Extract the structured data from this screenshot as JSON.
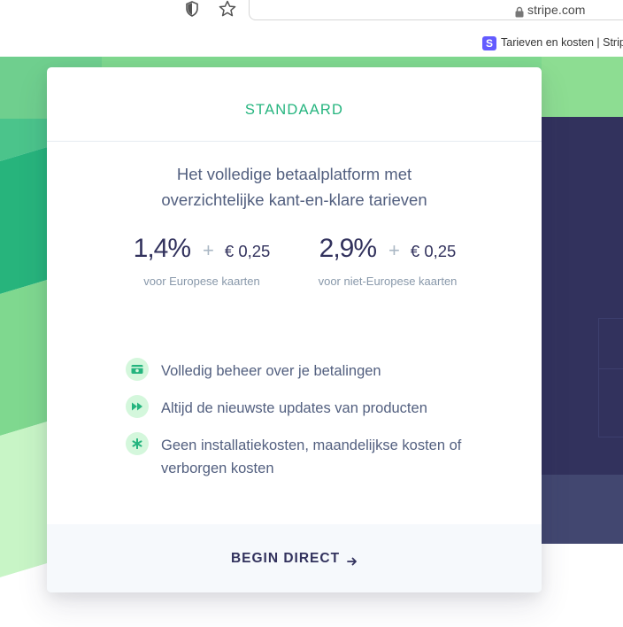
{
  "browser": {
    "url": "stripe.com",
    "tab_title": "Tarieven en kosten | Stripe",
    "favicon_letter": "S",
    "icons": [
      "shield-icon",
      "star-icon",
      "lock-icon"
    ]
  },
  "card": {
    "plan_name": "STANDAARD",
    "description_line1": "Het volledige betaalplatform met",
    "description_line2": "overzichtelijke kant-en-klare tarieven",
    "prices": [
      {
        "percent": "1,4%",
        "plus": "+",
        "fee": "€ 0,25",
        "note": "voor Europese kaarten"
      },
      {
        "percent": "2,9%",
        "plus": "+",
        "fee": "€ 0,25",
        "note": "voor niet-Europese kaarten"
      }
    ],
    "features": [
      {
        "icon": "wallet-icon",
        "text": "Volledig beheer over je betalingen"
      },
      {
        "icon": "fast-forward-icon",
        "text": "Altijd de nieuwste updates van producten"
      },
      {
        "icon": "asterisk-icon",
        "text": "Geen installatiekosten, maandelijkse kosten of verborgen kosten"
      }
    ],
    "cta_label": "BEGIN DIRECT",
    "cta_icon": "arrow-right-icon"
  },
  "colors": {
    "accent_green": "#24b47e",
    "text_dark": "#32325d",
    "text_body": "#525f7f",
    "text_muted": "#8898aa",
    "footer_bg": "#f6f9fc",
    "icon_bg": "#d4f7dc",
    "dark_panel": "#32325d",
    "favicon": "#635bff"
  }
}
